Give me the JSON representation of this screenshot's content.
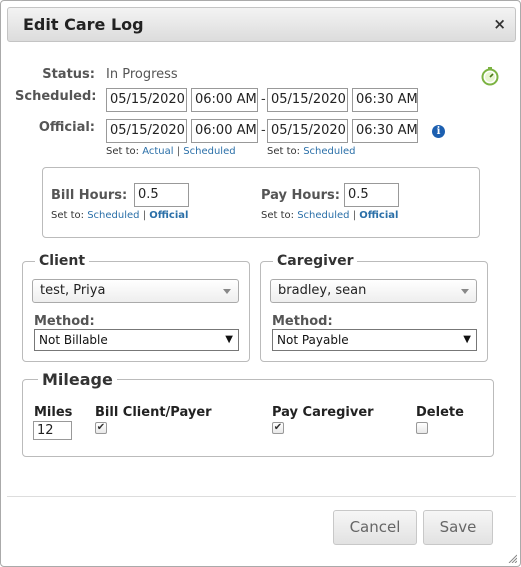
{
  "dialog": {
    "title": "Edit Care Log",
    "close_glyph": "×"
  },
  "status": {
    "label": "Status:",
    "value": "In Progress"
  },
  "scheduled": {
    "label": "Scheduled:",
    "start_date": "05/15/2020",
    "start_time": "06:00 AM",
    "end_date": "05/15/2020",
    "end_time": "06:30 AM"
  },
  "official": {
    "label": "Official:",
    "start_date": "05/15/2020",
    "start_time": "06:00 AM",
    "end_date": "05/15/2020",
    "end_time": "06:30 AM"
  },
  "set_to": {
    "prefix": "Set to:",
    "actual": "Actual",
    "separator": "|",
    "scheduled": "Scheduled",
    "official": "Official"
  },
  "hours": {
    "bill_label": "Bill Hours:",
    "bill_value": "0.5",
    "pay_label": "Pay Hours:",
    "pay_value": "0.5"
  },
  "client": {
    "legend": "Client",
    "name": "test, Priya",
    "method_label": "Method:",
    "method_value": "Not Billable"
  },
  "caregiver": {
    "legend": "Caregiver",
    "name": "bradley, sean",
    "method_label": "Method:",
    "method_value": "Not Payable"
  },
  "mileage": {
    "legend": "Mileage",
    "miles_label": "Miles",
    "miles_value": "12",
    "bill_label": "Bill Client/Payer",
    "bill_checked": true,
    "pay_label": "Pay Caregiver",
    "pay_checked": true,
    "delete_label": "Delete",
    "delete_checked": false,
    "check_glyph": "✔"
  },
  "buttons": {
    "cancel": "Cancel",
    "save": "Save"
  },
  "icons": {
    "timer": "stopwatch-icon",
    "info": "info-icon",
    "info_glyph": "i",
    "close": "close-icon"
  },
  "colors": {
    "link": "#2a6fa8",
    "info": "#1c5fb0",
    "timer": "#7cb342"
  }
}
